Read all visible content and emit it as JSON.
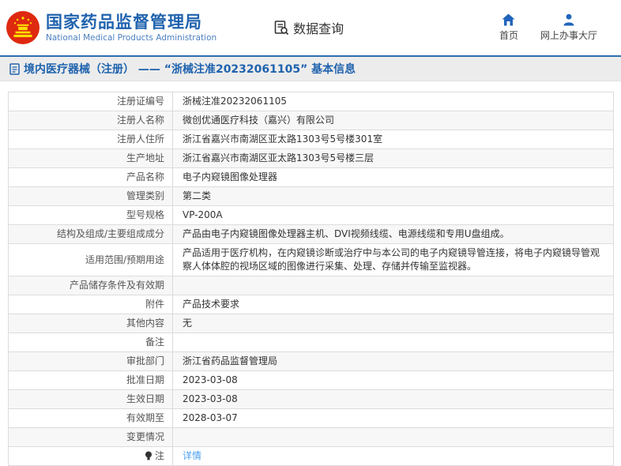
{
  "colors": {
    "accent_blue": "#2063ae",
    "subtitle_blue": "#4a7fc0",
    "link_blue": "#4ba1f0",
    "emblem_red": "#de2910",
    "emblem_yellow": "#ffde00",
    "crumb_bar_bg": "#ececec",
    "row_alt_bg": "#f7f7f7",
    "border": "#dcdcdc"
  },
  "header": {
    "brand": {
      "emblem_icon": "china-national-emblem-icon",
      "title": "国家药品监督管理局",
      "subtitle": "National Medical Products Administration"
    },
    "section": {
      "icon": "document-search-icon",
      "label": "数据查询"
    },
    "nav": [
      {
        "icon": "home-icon",
        "label": "首页"
      },
      {
        "icon": "person-icon",
        "label": "网上办事大厅"
      }
    ]
  },
  "breadcrumb": {
    "icon": "document-icon",
    "text": "境内医疗器械（注册） —— “浙械注准20232061105” 基本信息"
  },
  "table": {
    "rows": [
      {
        "label": "注册证编号",
        "value": "浙械注准20232061105"
      },
      {
        "label": "注册人名称",
        "value": "微创优通医疗科技（嘉兴）有限公司"
      },
      {
        "label": "注册人住所",
        "value": "浙江省嘉兴市南湖区亚太路1303号5号楼301室"
      },
      {
        "label": "生产地址",
        "value": "浙江省嘉兴市南湖区亚太路1303号5号楼三层"
      },
      {
        "label": "产品名称",
        "value": "电子内窥镜图像处理器"
      },
      {
        "label": "管理类别",
        "value": "第二类"
      },
      {
        "label": "型号规格",
        "value": "VP-200A"
      },
      {
        "label": "结构及组成/主要组成成分",
        "value": "产品由电子内窥镜图像处理器主机、DVI视频线缆、电源线缆和专用U盘组成。"
      },
      {
        "label": "适用范围/预期用途",
        "value": "产品适用于医疗机构，在内窥镜诊断或治疗中与本公司的电子内窥镜导管连接，将电子内窥镜导管观察人体体腔的视场区域的图像进行采集、处理、存储并传输至监视器。"
      },
      {
        "label": "产品储存条件及有效期",
        "value": ""
      },
      {
        "label": "附件",
        "value": "产品技术要求"
      },
      {
        "label": "其他内容",
        "value": "无"
      },
      {
        "label": "备注",
        "value": ""
      },
      {
        "label": "审批部门",
        "value": "浙江省药品监督管理局"
      },
      {
        "label": "批准日期",
        "value": "2023-03-08"
      },
      {
        "label": "生效日期",
        "value": "2023-03-08"
      },
      {
        "label": "有效期至",
        "value": "2028-03-07"
      },
      {
        "label": "变更情况",
        "value": ""
      },
      {
        "label": "注",
        "label_icon": "bulb-icon",
        "value": "详情",
        "value_is_link": true
      }
    ]
  }
}
